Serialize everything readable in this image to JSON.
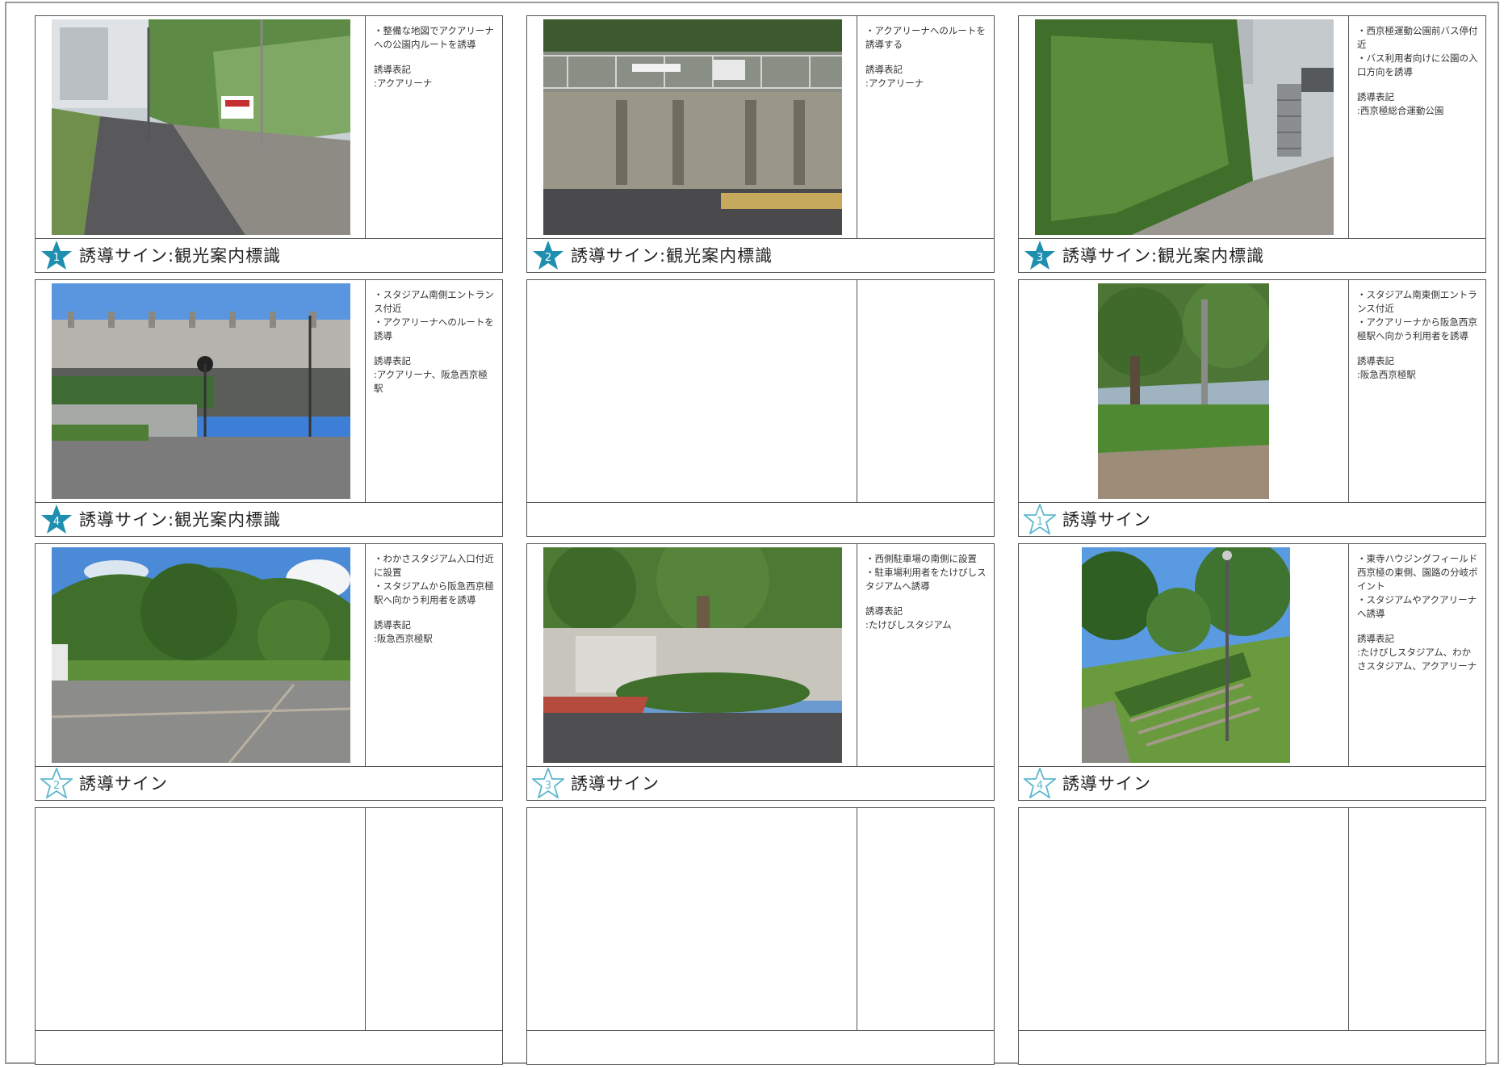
{
  "cards": [
    {
      "notes": [
        "・整備な地図でアクアリーナへの公園内ルートを誘導",
        "誘導表記\n:アクアリーナ"
      ],
      "footer_label": "誘導サイン:観光案内標識",
      "badge_number": "1",
      "badge_style": "filled",
      "photo_name": "park-path-with-fence-photo"
    },
    {
      "notes": [
        "・アクアリーナへのルートを誘導する",
        "誘導表記\n:アクアリーナ"
      ],
      "footer_label": "誘導サイン:観光案内標識",
      "badge_number": "2",
      "badge_style": "filled",
      "photo_name": "concrete-wall-with-railing-photo"
    },
    {
      "notes": [
        "・西京極運動公園前バス停付近\n・バス利用者向けに公園の入口方向を誘導",
        "誘導表記\n:西京極総合運動公園"
      ],
      "footer_label": "誘導サイン:観光案内標識",
      "badge_number": "3",
      "badge_style": "filled",
      "photo_name": "hedge-walkway-photo"
    },
    {
      "notes": [
        "・スタジアム南側エントランス付近\n・アクアリーナへのルートを誘導",
        "誘導表記\n:アクアリーナ、阪急西京極駅"
      ],
      "footer_label": "誘導サイン:観光案内標識",
      "badge_number": "4",
      "badge_style": "filled",
      "photo_name": "railway-bridge-underpass-photo"
    },
    {
      "notes": [],
      "footer_label": "",
      "badge_number": "",
      "badge_style": "none",
      "photo_name": ""
    },
    {
      "notes": [
        "・スタジアム南東側エントランス付近\n・アクアリーナから阪急西京極駅へ向かう利用者を誘導",
        "誘導表記\n:阪急西京極駅"
      ],
      "footer_label": "誘導サイン",
      "badge_number": "1",
      "badge_style": "outline",
      "photo_name": "park-tree-pole-photo"
    },
    {
      "notes": [
        "・わかさスタジアム入口付近に設置\n・スタジアムから阪急西京極駅へ向かう利用者を誘導",
        "誘導表記\n:阪急西京極駅"
      ],
      "footer_label": "誘導サイン",
      "badge_number": "2",
      "badge_style": "outline",
      "photo_name": "parking-lot-trees-photo"
    },
    {
      "notes": [
        "・西側駐車場の南側に設置\n・駐車場利用者をたけびしスタジアムへ誘導",
        "誘導表記\n:たけびしスタジアム"
      ],
      "footer_label": "誘導サイン",
      "badge_number": "3",
      "badge_style": "outline",
      "photo_name": "tree-island-parking-photo"
    },
    {
      "notes": [
        "・東寺ハウジングフィールド西京極の東側、園路の分岐ポイント\n・スタジアムやアクアリーナへ誘導",
        "誘導表記\n:たけびしスタジアム、わかさスタジアム、アクアリーナ"
      ],
      "footer_label": "誘導サイン",
      "badge_number": "4",
      "badge_style": "outline",
      "photo_name": "garden-steps-lamp-photo"
    },
    {
      "notes": [],
      "footer_label": "",
      "badge_number": "",
      "badge_style": "none",
      "photo_name": ""
    },
    {
      "notes": [],
      "footer_label": "",
      "badge_number": "",
      "badge_style": "none",
      "photo_name": ""
    },
    {
      "notes": [],
      "footer_label": "",
      "badge_number": "",
      "badge_style": "none",
      "photo_name": ""
    }
  ],
  "colors": {
    "badge_filled": "#1f8fb0",
    "badge_outline": "#5fb8cf",
    "border": "#555555"
  }
}
